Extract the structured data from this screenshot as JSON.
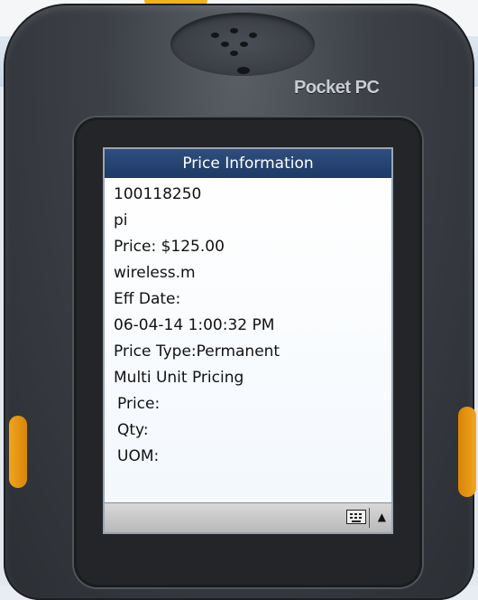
{
  "device": {
    "brand": "Pocket PC"
  },
  "window": {
    "title": "Price Information"
  },
  "content": {
    "lines": [
      "100118250",
      "pi",
      "Price:   $125.00",
      "wireless.m",
      "Eff Date:",
      "06-04-14 1:00:32 PM",
      "Price Type:Permanent",
      "Multi Unit Pricing",
      " Price:",
      " Qty:",
      " UOM:"
    ]
  },
  "taskbar": {
    "keyboard_icon": "keyboard-icon",
    "sip_toggle_icon": "up-arrow-icon",
    "sip_toggle_glyph": "▲"
  },
  "colors": {
    "titlebar": "#1e3a66",
    "accent_orange": "#f0a51c"
  }
}
